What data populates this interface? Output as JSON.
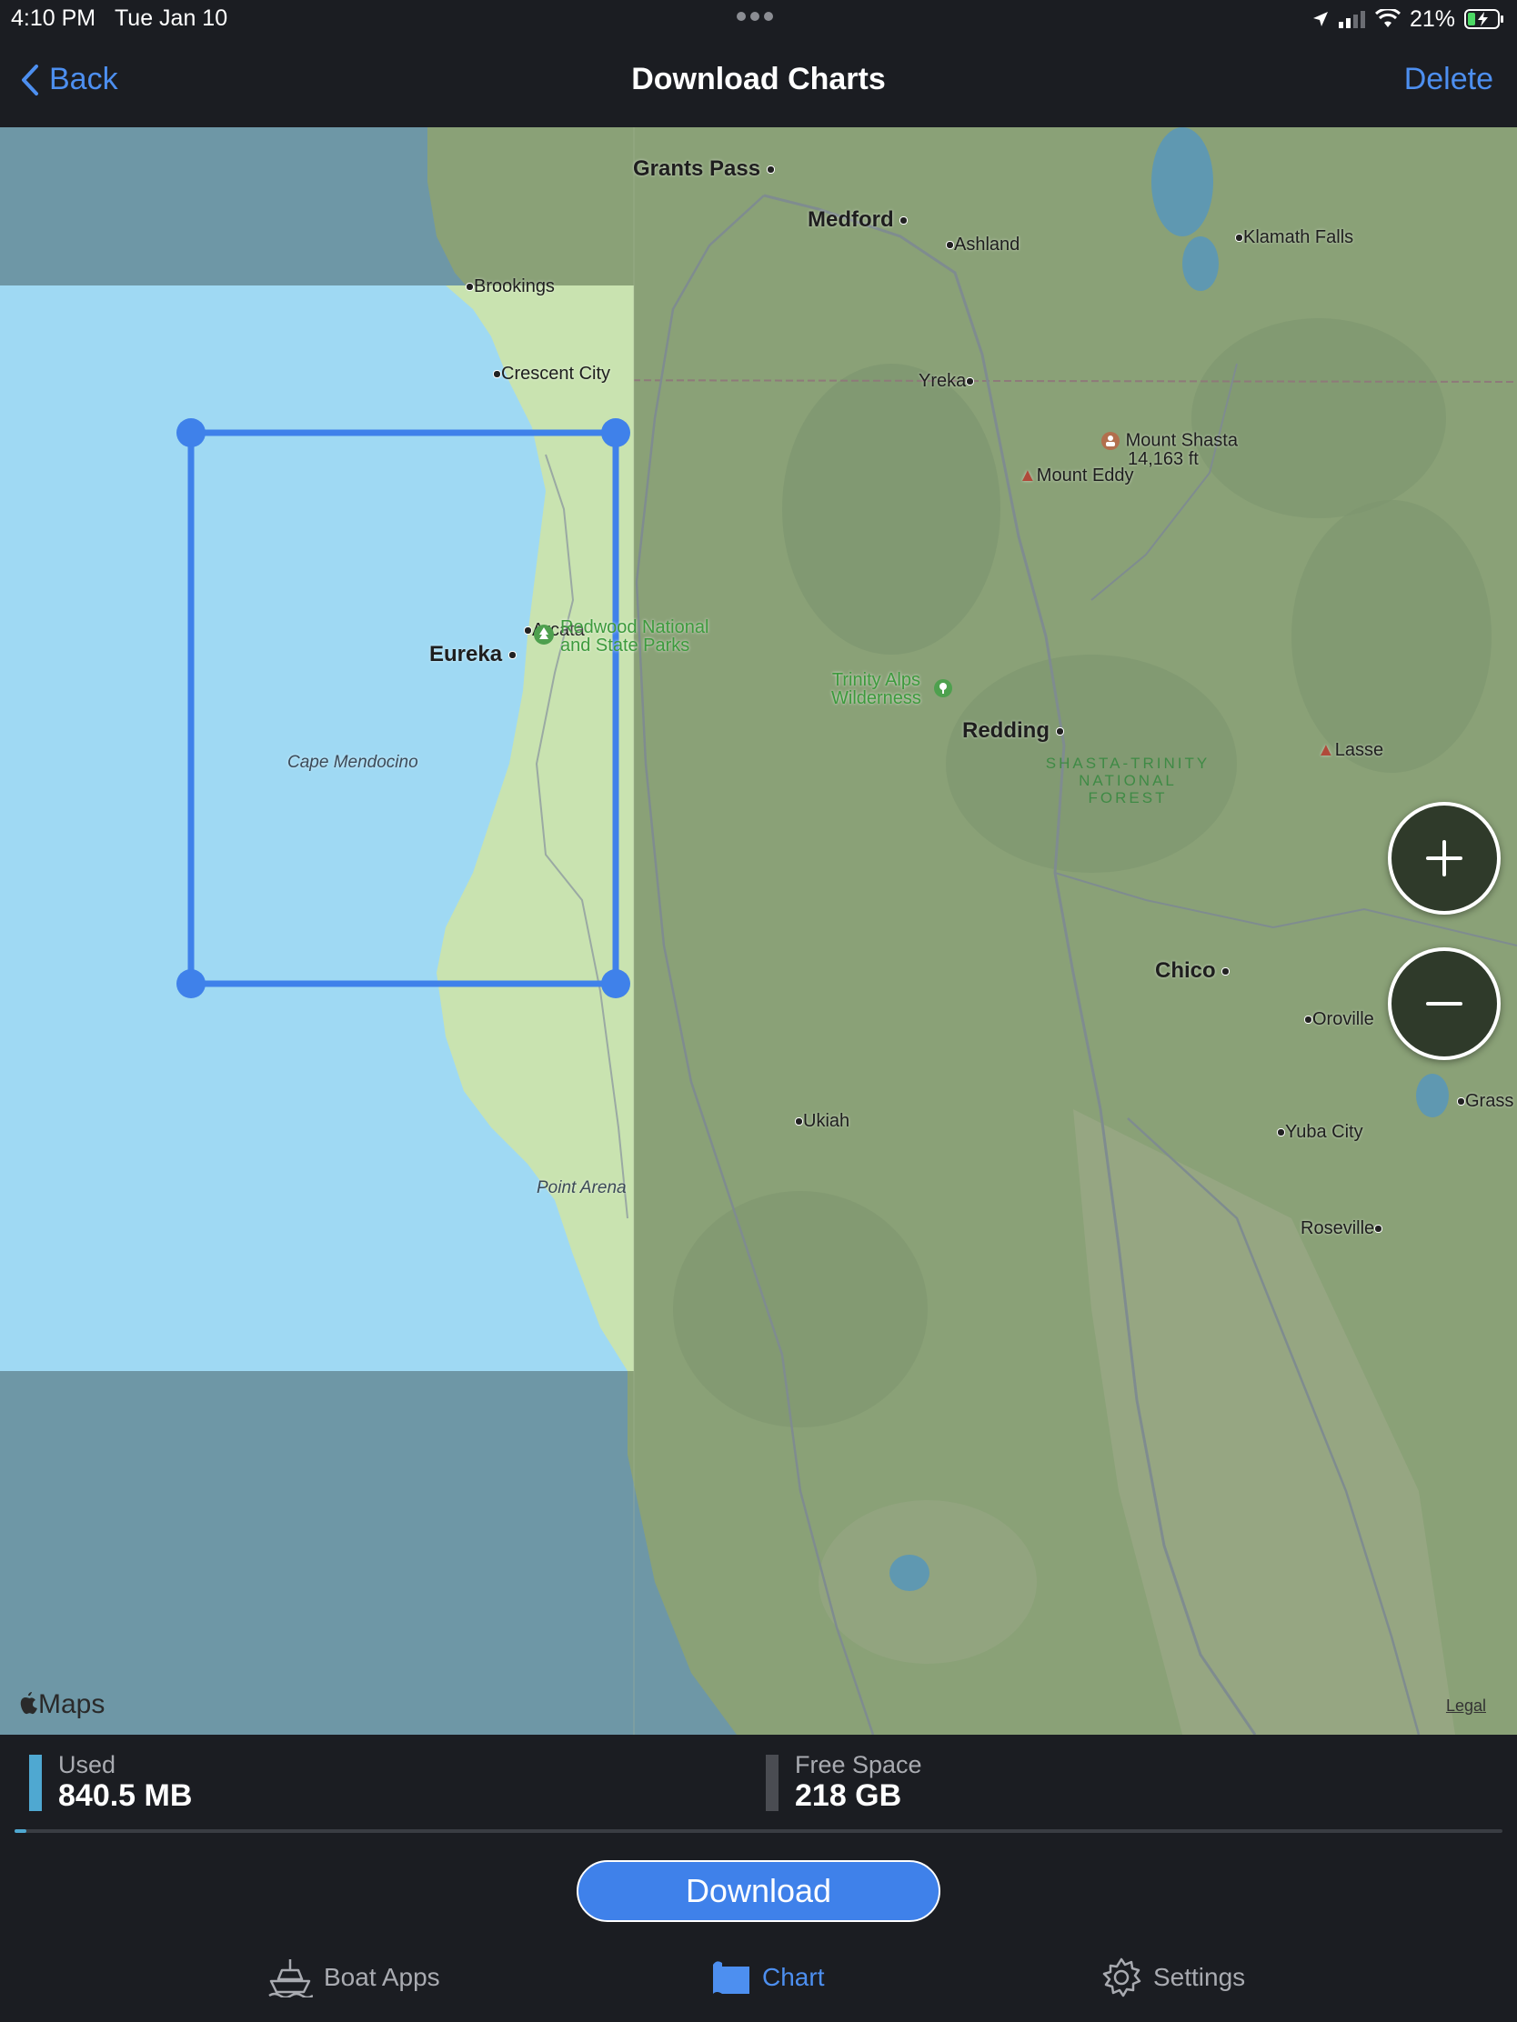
{
  "status_bar": {
    "time": "4:10 PM",
    "date": "Tue Jan 10",
    "battery_percent": "21%",
    "icons": [
      "location-arrow-icon",
      "cellular-signal-icon",
      "wifi-icon",
      "battery-charging-icon"
    ]
  },
  "nav": {
    "back_label": "Back",
    "title": "Download Charts",
    "delete_label": "Delete"
  },
  "map": {
    "places": {
      "grants_pass": "Grants Pass",
      "medford": "Medford",
      "ashland": "Ashland",
      "klamath_falls": "Klamath Falls",
      "brookings": "Brookings",
      "crescent_city": "Crescent City",
      "yreka": "Yreka",
      "mount_shasta": "Mount Shasta",
      "mount_shasta_elev": "14,163 ft",
      "mount_eddy": "Mount Eddy",
      "arcata": "Arcata",
      "eureka": "Eureka",
      "redding": "Redding",
      "lassen": "Lasse",
      "chico": "Chico",
      "oroville": "Oroville",
      "ukiah": "Ukiah",
      "yuba_city": "Yuba City",
      "grass": "Grass",
      "roseville": "Roseville"
    },
    "parks": {
      "redwood_line1": "Redwood National",
      "redwood_line2": "and State Parks",
      "trinity_line1": "Trinity Alps",
      "trinity_line2": "Wilderness"
    },
    "forest": {
      "line1": "SHASTA-TRINITY",
      "line2": "NATIONAL",
      "line3": "FOREST"
    },
    "coastal": {
      "cape_mendocino": "Cape Mendocino",
      "point_arena": "Point Arena"
    },
    "attribution": "Maps",
    "legal": "Legal",
    "zoom_in_icon": "plus-icon",
    "zoom_out_icon": "minus-icon"
  },
  "storage": {
    "used_label": "Used",
    "used_value": "840.5 MB",
    "free_label": "Free Space",
    "free_value": "218 GB",
    "used_fraction": 0.004,
    "used_color": "#4fa8d1",
    "free_color": "#4a4c52"
  },
  "download_label": "Download",
  "tabs": [
    {
      "label": "Boat Apps",
      "icon": "boat-icon",
      "active": false
    },
    {
      "label": "Chart",
      "icon": "chart-map-icon",
      "active": true
    },
    {
      "label": "Settings",
      "icon": "gear-icon",
      "active": false
    }
  ],
  "colors": {
    "accent": "#4d8ff0",
    "selection": "#3f81ea",
    "water_selected": "#9fd9f3",
    "land_selected": "#c9e3b0",
    "ocean": "#6e97a6",
    "land": "#8aa177"
  }
}
